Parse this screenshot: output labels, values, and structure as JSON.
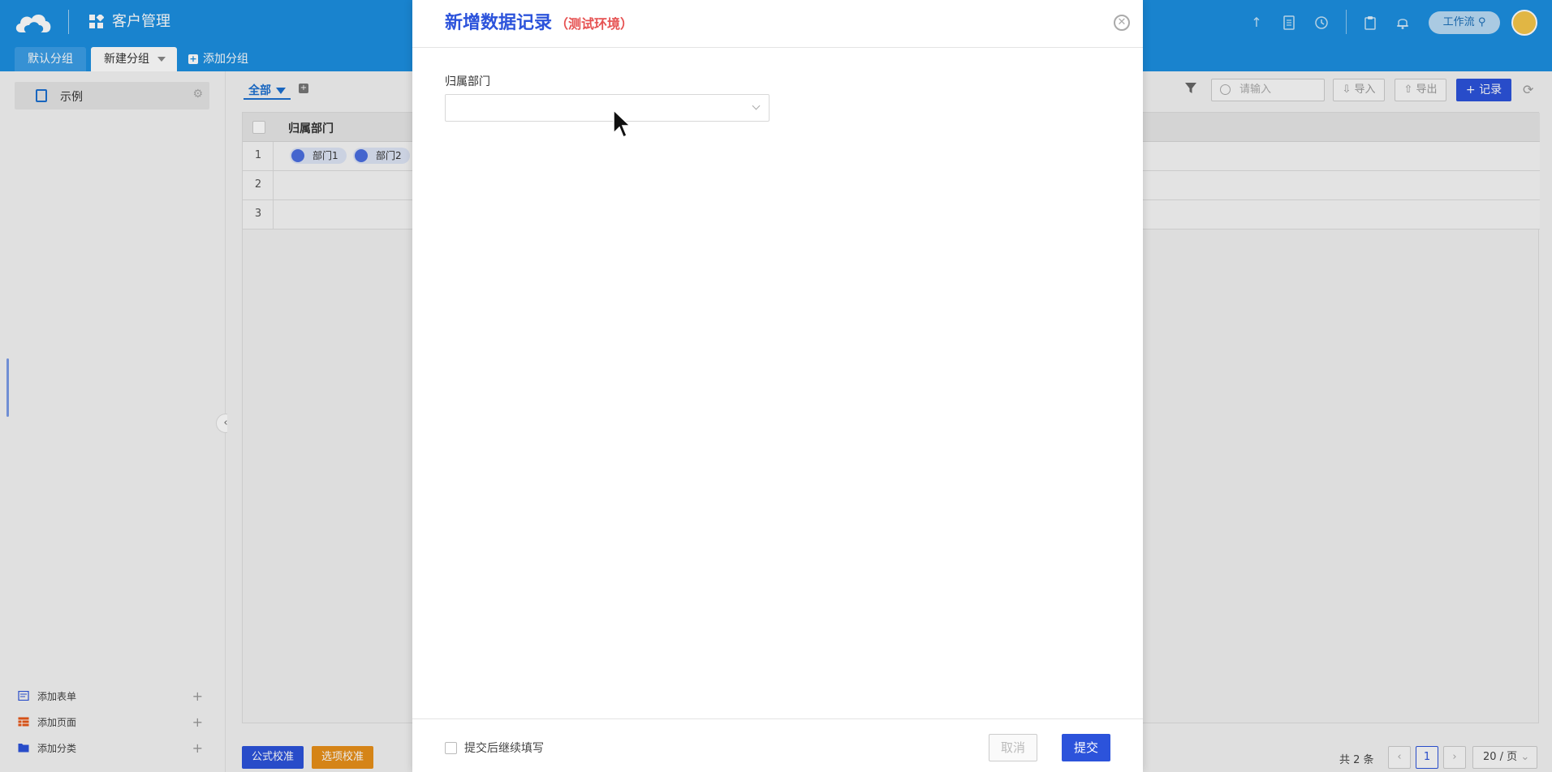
{
  "header": {
    "app_title": "客户管理",
    "tabs": [
      {
        "label": "默认分组"
      },
      {
        "label": "新建分组"
      },
      {
        "label": "添加分组"
      }
    ],
    "workflow_label": "工作流",
    "icons": [
      "upload-icon",
      "document-icon",
      "history-icon",
      "clipboard-icon",
      "bell-icon"
    ],
    "accent_color": "#1c8fe0"
  },
  "sidebar": {
    "items": [
      {
        "label": "示例"
      }
    ],
    "bottom": [
      {
        "label": "添加表单"
      },
      {
        "label": "添加页面"
      },
      {
        "label": "添加分类"
      }
    ]
  },
  "main": {
    "view_label": "全部",
    "search_placeholder": "请输入",
    "import_label": "导入",
    "export_label": "导出",
    "record_label": "记录",
    "grid": {
      "column": "归属部门",
      "rows": [
        {
          "num": "1",
          "tags": [
            "部门1",
            "部门2"
          ]
        },
        {
          "num": "2",
          "tags": []
        },
        {
          "num": "3",
          "tags": []
        }
      ]
    },
    "formula_btn": "公式校准",
    "option_btn": "选项校准",
    "pager": {
      "total": "共 2 条",
      "current": "1",
      "page_size": "20 / 页"
    }
  },
  "modal": {
    "title": "新增数据记录",
    "env": "（测试环境）",
    "field_label": "归属部门",
    "field_value": "",
    "continue_label": "提交后继续填写",
    "cancel_label": "取消",
    "submit_label": "提交",
    "primary_color": "#2c53db"
  }
}
